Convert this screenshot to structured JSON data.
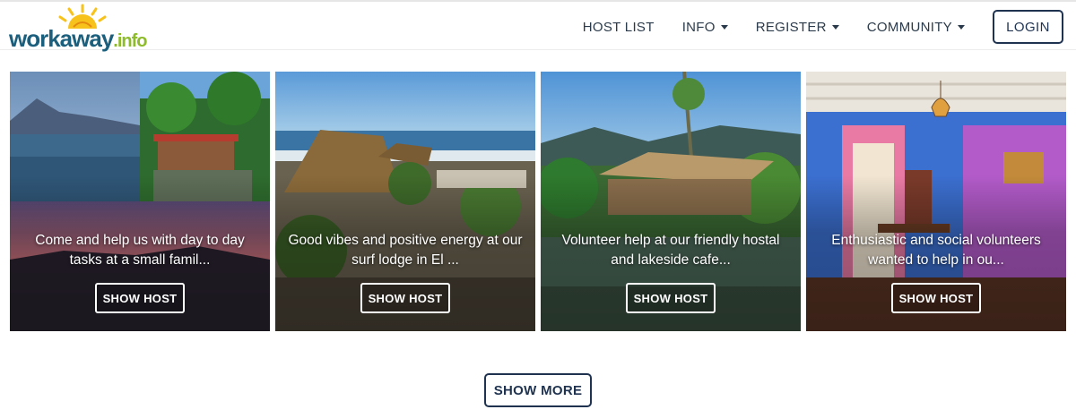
{
  "header": {
    "logo": {
      "name": "workaway",
      "suffix": ".info"
    },
    "nav": [
      {
        "label": "HOST LIST",
        "dropdown": false
      },
      {
        "label": "INFO",
        "dropdown": true
      },
      {
        "label": "REGISTER",
        "dropdown": true
      },
      {
        "label": "COMMUNITY",
        "dropdown": true
      }
    ],
    "login_label": "LOGIN"
  },
  "cards": [
    {
      "description": "Come and help us with day to day tasks at a small famil...",
      "button_label": "SHOW HOST"
    },
    {
      "description": "Good vibes and positive energy at our surf lodge in El ...",
      "button_label": "SHOW HOST"
    },
    {
      "description": "Volunteer help at our friendly hostal and lakeside cafe...",
      "button_label": "SHOW HOST"
    },
    {
      "description": "Enthusiastic and social volunteers wanted to help in ou...",
      "button_label": "SHOW HOST"
    }
  ],
  "show_more_label": "SHOW MORE",
  "colors": {
    "brand_blue": "#1b5f7d",
    "brand_green": "#8dbb2b",
    "button_border": "#1f3350"
  }
}
